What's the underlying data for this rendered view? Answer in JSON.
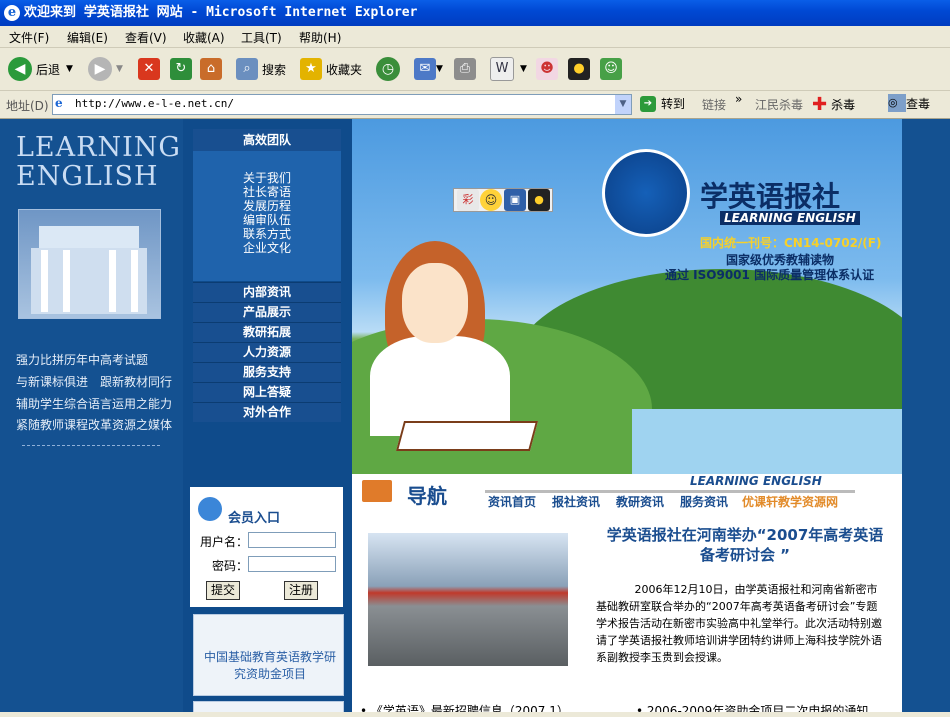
{
  "window": {
    "title": "欢迎来到 学英语报社 网站 - Microsoft Internet Explorer"
  },
  "menu": [
    "文件(F)",
    "编辑(E)",
    "查看(V)",
    "收藏(A)",
    "工具(T)",
    "帮助(H)"
  ],
  "toolbar": {
    "back": "后退",
    "search": "搜索",
    "favorites": "收藏夹"
  },
  "address": {
    "label": "地址(D)",
    "url": "http://www.e-l-e.net.cn/",
    "go": "转到",
    "links": "链接",
    "ext1": "江民杀毒",
    "ext2": "杀毒",
    "ext3": "查毒"
  },
  "left": {
    "logo_line1": "LEARNING",
    "logo_line2": "ENGLISH",
    "slogans": [
      "强力比拼历年中高考试题",
      "与新课标俱进　跟新教材同行",
      "辅助学生综合语言运用之能力",
      "紧随教师课程改革资源之媒体"
    ]
  },
  "nav": {
    "team_title": "高效团队",
    "team_links": [
      "关于我们",
      "社长寄语",
      "发展历程",
      "编审队伍",
      "联系方式",
      "企业文化"
    ],
    "items": [
      "内部资讯",
      "产品展示",
      "教研拓展",
      "人力资源",
      "服务支持",
      "网上答疑",
      "对外合作"
    ]
  },
  "login": {
    "title": "会员入口",
    "user_label": "用户名：",
    "pass_label": "密码：",
    "submit": "提交",
    "register": "注册"
  },
  "fund": {
    "text": "中国基础教育英语教学研究资助金项目"
  },
  "banner": {
    "logo_cn": "学英语报社",
    "logo_en": "LEARNING ENGLISH",
    "cn_number": "国内统一刊号：CN14-0702/(F)",
    "line2": "国家级优秀教辅读物",
    "line3": "通过 ISO9001 国际质量管理体系认证"
  },
  "guide": {
    "title": "导航",
    "brand": "LEARNING ENGLISH",
    "links": [
      "资讯首页",
      "报社资讯",
      "教研资讯",
      "服务资讯",
      "优课轩教学资源网"
    ]
  },
  "news": {
    "title": "学英语报社在河南举办“2007年高考英语备考研讨会 ”",
    "body": "2006年12月10日，由学英语报社和河南省新密市基础教研室联合举办的“2007年高考英语备考研讨会”专题学术报告活动在新密市实验高中礼堂举行。此次活动特别邀请了学英语报社教师培训讲学团特约讲师上海科技学院外语系副教授李玉贵到会授课。",
    "bottom1": "《学英语》最新招聘信息（2007.1）",
    "bottom2": "2006-2009年资助金项目二次申报的通知"
  }
}
